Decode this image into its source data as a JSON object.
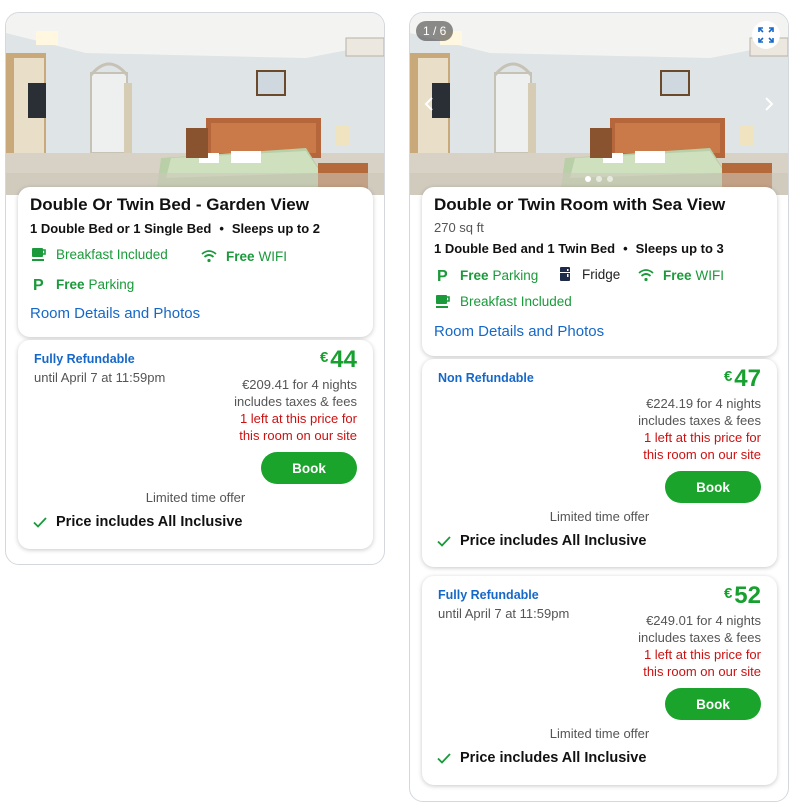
{
  "cards": [
    {
      "title": "Double Or Twin Bed - Garden View",
      "beds": "1 Double Bed or 1 Single Bed",
      "sleeps": "Sleeps up to 2",
      "amenities": [
        {
          "icon": "coffee-cup-icon",
          "strong": "",
          "text": "Breakfast Included"
        },
        {
          "icon": "wifi-icon",
          "strong": "Free",
          "text": "WIFI"
        },
        {
          "icon": "parking-icon",
          "strong": "Free",
          "text": "Parking"
        }
      ],
      "details_link": "Room Details and Photos",
      "offers": [
        {
          "refund": "Fully Refundable",
          "until": "until April 7 at 11:59pm",
          "currency": "€",
          "price": "44",
          "total": "€209.41 for 4 nights",
          "taxes": "includes taxes & fees",
          "scarcity_1": "1 left at this price for",
          "scarcity_2": "this room on our site",
          "book_label": "Book",
          "limited": "Limited time offer",
          "includes": "Price includes All Inclusive"
        }
      ]
    },
    {
      "title": "Double or Twin Room with Sea View",
      "size": "270 sq ft",
      "beds": "1 Double Bed and 1 Twin Bed",
      "sleeps": "Sleeps up to 3",
      "photo_counter": "1 / 6",
      "amenities": [
        {
          "icon": "parking-icon",
          "strong": "Free",
          "text": "Parking"
        },
        {
          "icon": "fridge-icon",
          "strong": "",
          "text": "Fridge"
        },
        {
          "icon": "wifi-icon",
          "strong": "Free",
          "text": "WIFI"
        },
        {
          "icon": "coffee-cup-icon",
          "strong": "",
          "text": "Breakfast Included"
        }
      ],
      "details_link": "Room Details and Photos",
      "offers": [
        {
          "refund": "Non Refundable",
          "currency": "€",
          "price": "47",
          "total": "€224.19 for 4 nights",
          "taxes": "includes taxes & fees",
          "scarcity_1": "1 left at this price for",
          "scarcity_2": "this room on our site",
          "book_label": "Book",
          "limited": "Limited time offer",
          "includes": "Price includes All Inclusive"
        },
        {
          "refund": "Fully Refundable",
          "until": "until April 7 at 11:59pm",
          "currency": "€",
          "price": "52",
          "total": "€249.01 for 4 nights",
          "taxes": "includes taxes & fees",
          "scarcity_1": "1 left at this price for",
          "scarcity_2": "this room on our site",
          "book_label": "Book",
          "limited": "Limited time offer",
          "includes": "Price includes All Inclusive"
        }
      ]
    }
  ],
  "colors": {
    "price_green": "#17a02f",
    "book_green": "#1aa42b",
    "link_blue": "#1668c8",
    "scarcity_red": "#cc1111"
  }
}
